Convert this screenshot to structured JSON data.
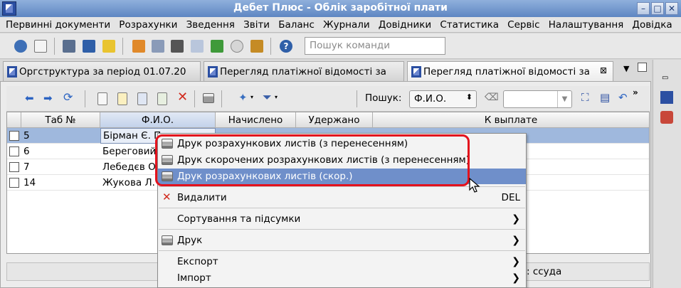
{
  "window": {
    "title": "Дебет Плюс - Облік заробітної плати"
  },
  "menu": [
    "Первинні документи",
    "Розрахунки",
    "Зведення",
    "Звіти",
    "Баланс",
    "Журнали",
    "Довідники",
    "Статистика",
    "Сервіс",
    "Налаштування",
    "Довідка"
  ],
  "toolbar": {
    "command_search_placeholder": "Пошук команди"
  },
  "tabs": [
    {
      "label": "Оргструктура за період 01.07.20"
    },
    {
      "label": "Перегляд платіжної відомості за"
    },
    {
      "label": "Перегляд платіжної відомості за"
    }
  ],
  "filter": {
    "search_label": "Пошук:",
    "search_field_value": "Ф.И.О."
  },
  "table": {
    "columns": [
      "Таб №",
      "Ф.И.О.",
      "Начислено",
      "Удержано",
      "К выплате"
    ],
    "rows": [
      {
        "tab": "5",
        "name": "Бірман Є. П.",
        "selected": true
      },
      {
        "tab": "6",
        "name": "Береговий"
      },
      {
        "tab": "7",
        "name": "Лебедєв О."
      },
      {
        "tab": "14",
        "name": "Жукова Л."
      }
    ]
  },
  "status": {
    "text": ": ссуда"
  },
  "context_menu": {
    "items": [
      {
        "label": "Друк розрахункових листів (з перенесенням)"
      },
      {
        "label": "Друк скорочених розрахункових листів (з перенесенням)"
      },
      {
        "label": "Друк розрахункових листів (скор.)",
        "highlighted": true
      },
      {
        "label": "Видалити",
        "accel": "DEL"
      },
      {
        "label": "Сортування та підсумки"
      },
      {
        "label": "Друк"
      },
      {
        "label": "Експорт"
      },
      {
        "label": "Імпорт"
      }
    ]
  },
  "colors": {
    "title_bar": "#6f93c8",
    "selection": "#9fb8dd",
    "menu_highlight": "#6f8fca",
    "annotation": "#e3121d"
  }
}
